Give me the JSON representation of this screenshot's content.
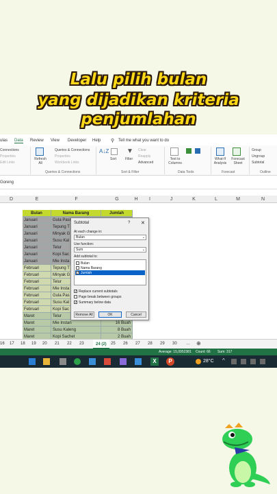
{
  "caption": {
    "line1": "Lalu pilih bulan",
    "line2": "yang dijadikan kriteria",
    "line3": "penjumlahan"
  },
  "menu": {
    "items": [
      "ulas",
      "Data",
      "Review",
      "View",
      "Developer",
      "Help"
    ],
    "search": "Tell me what you want to do"
  },
  "ribbon": {
    "connections": "Connections",
    "properties": "Properties",
    "edit_links": "Edit Links",
    "refresh_all": "Refresh All",
    "queries_connections": "Queries & Connections",
    "queries_properties": "Properties",
    "workbook_links": "Workbook Links",
    "group_queries": "Queries & Connections",
    "sort": "Sort",
    "filter": "Filter",
    "clear": "Clear",
    "reapply": "Reapply",
    "advanced": "Advanced",
    "group_sort": "Sort & Filter",
    "text_to_columns": "Text to Columns",
    "group_datatools": "Data Tools",
    "what_if": "What-If Analysis",
    "forecast_sheet": "Forecast Sheet",
    "group_forecast": "Forecast",
    "group_btn": "Group",
    "ungroup_btn": "Ungroup",
    "subtotal_btn": "Subtotal",
    "group_outline": "Outline"
  },
  "formula_bar": {
    "value": "Goreng"
  },
  "columns": [
    "D",
    "E",
    "F",
    "G",
    "H",
    "I",
    "J",
    "K",
    "L",
    "M",
    "N"
  ],
  "table": {
    "headers": [
      "Bulan",
      "Nama Barang",
      "Jumlah"
    ],
    "rows": [
      [
        "Januari",
        "Gula Pasir",
        ""
      ],
      [
        "Januari",
        "Tepung T",
        ""
      ],
      [
        "Januari",
        "Minyak G",
        ""
      ],
      [
        "Januari",
        "Susu Kal",
        ""
      ],
      [
        "Januari",
        "Telur",
        ""
      ],
      [
        "Januari",
        "Kopi Sac",
        ""
      ],
      [
        "Januari",
        "Mie Insta",
        ""
      ],
      [
        "Februari",
        "Tepung T",
        ""
      ],
      [
        "Februari",
        "Minyak G",
        ""
      ],
      [
        "Februari",
        "Telur",
        ""
      ],
      [
        "Februari",
        "Mie Insta",
        ""
      ],
      [
        "Februari",
        "Gula Pas",
        ""
      ],
      [
        "Februari",
        "Susu Kal",
        ""
      ],
      [
        "Februari",
        "Kopi Sac",
        ""
      ],
      [
        "Maret",
        "Telur",
        ""
      ],
      [
        "Maret",
        "Mie Instan",
        "16 Buah"
      ],
      [
        "Maret",
        "Susu Kaleng",
        "8 Buah"
      ],
      [
        "Maret",
        "Kopi Sachet",
        "2 Buah"
      ]
    ]
  },
  "dialog": {
    "title": "Subtotal",
    "help": "?",
    "close": "✕",
    "at_each_change_label": "At each change in:",
    "at_each_change_value": "Bulan",
    "use_function_label": "Use function:",
    "use_function_value": "Sum",
    "add_subtotal_label": "Add subtotal to:",
    "fields": [
      {
        "label": "Bulan",
        "checked": false
      },
      {
        "label": "Nama Barang",
        "checked": false
      },
      {
        "label": "Jumlah",
        "checked": true
      }
    ],
    "replace_current": "Replace current subtotals",
    "page_break": "Page break between groups",
    "summary_below": "Summary below data",
    "remove_all": "Remove All",
    "ok": "OK",
    "cancel": "Cancel"
  },
  "sheet_tabs": [
    "16",
    "17",
    "18",
    "19",
    "20",
    "21",
    "22",
    "23",
    "24 (2)",
    "25",
    "26",
    "27",
    "28",
    "29",
    "30"
  ],
  "active_tab": "24 (2)",
  "status": {
    "average": "Average: 15,0952381",
    "count": "Count: 66",
    "sum": "Sum: 317"
  },
  "taskbar": {
    "temperature": "28°C",
    "excel_badge": "X",
    "pp_badge": "P"
  },
  "colors": {
    "caption": "#ffd817",
    "excel_green": "#217346",
    "header_fill": "#c4d92e",
    "januari_fill": "#a5a5a5",
    "februari_fill": "#d0d8b0",
    "maret_fill": "#b7c9a7"
  }
}
